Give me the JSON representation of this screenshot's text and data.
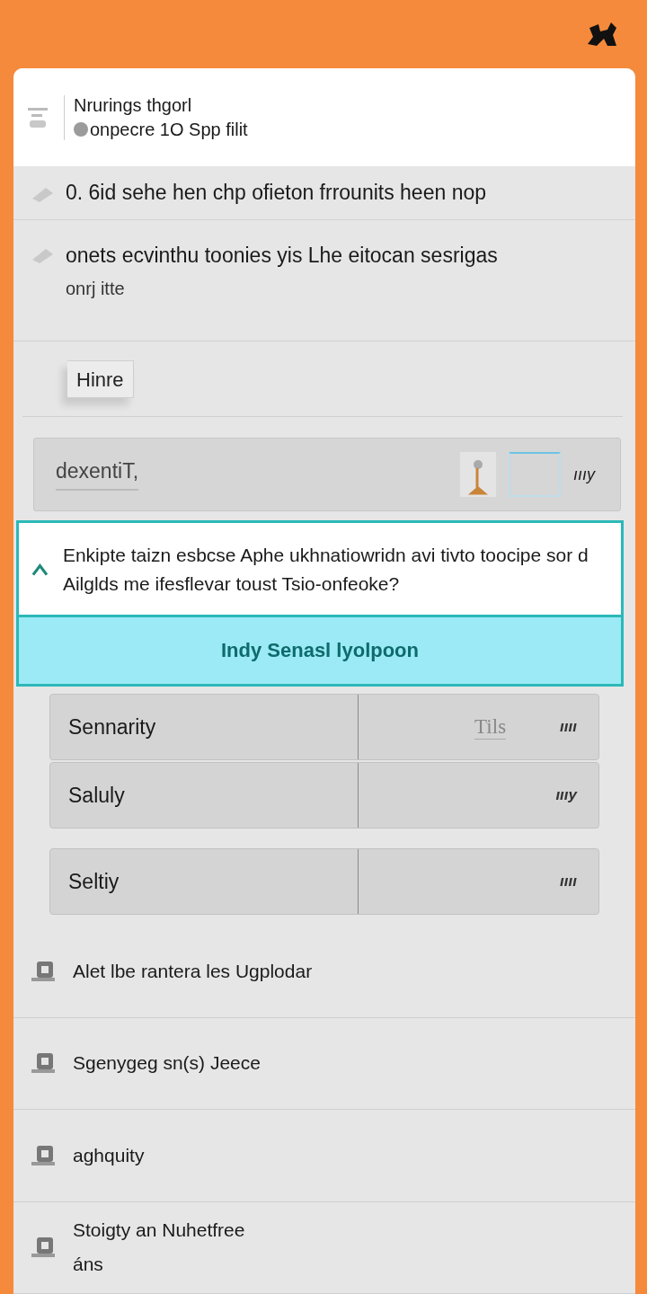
{
  "header": {
    "title": "Nrurings thgorl",
    "subtitle": "onpecre 1O  Spp filit"
  },
  "notices": [
    {
      "text": "0. 6id sehe hen chp ofieton frrounits heen nop"
    },
    {
      "text": "onets ecvinthu toonies yis Lhe eitocan sesrigas",
      "detail": "onrj itte"
    }
  ],
  "tag": {
    "label": "Hinre"
  },
  "search": {
    "value": "dexentiT,",
    "reading": "ıııy"
  },
  "alert": {
    "message": "Enkipte taizn esbcse Aphe ukhnatiowridn avi tivto toocipe sor d Ailglds me ifesflevar toust Tsio-onfeoke?",
    "action": "Indy Senasl lyolpoon",
    "expanded": true
  },
  "rows": [
    {
      "label": "Sennarity",
      "value": "Tils",
      "reading": "ıııı"
    },
    {
      "label": "Saluly",
      "reading": "ıııy"
    },
    {
      "label": "Seltiy",
      "reading": "ıııı"
    }
  ],
  "list": [
    {
      "text": "Alet lbe rantera les Ugplodar"
    },
    {
      "text": "Sgenygeg sn(s) Jeece"
    },
    {
      "text": "aghquity"
    },
    {
      "text": "Stoigty an Nuhetfree",
      "detail": "áns"
    }
  ]
}
